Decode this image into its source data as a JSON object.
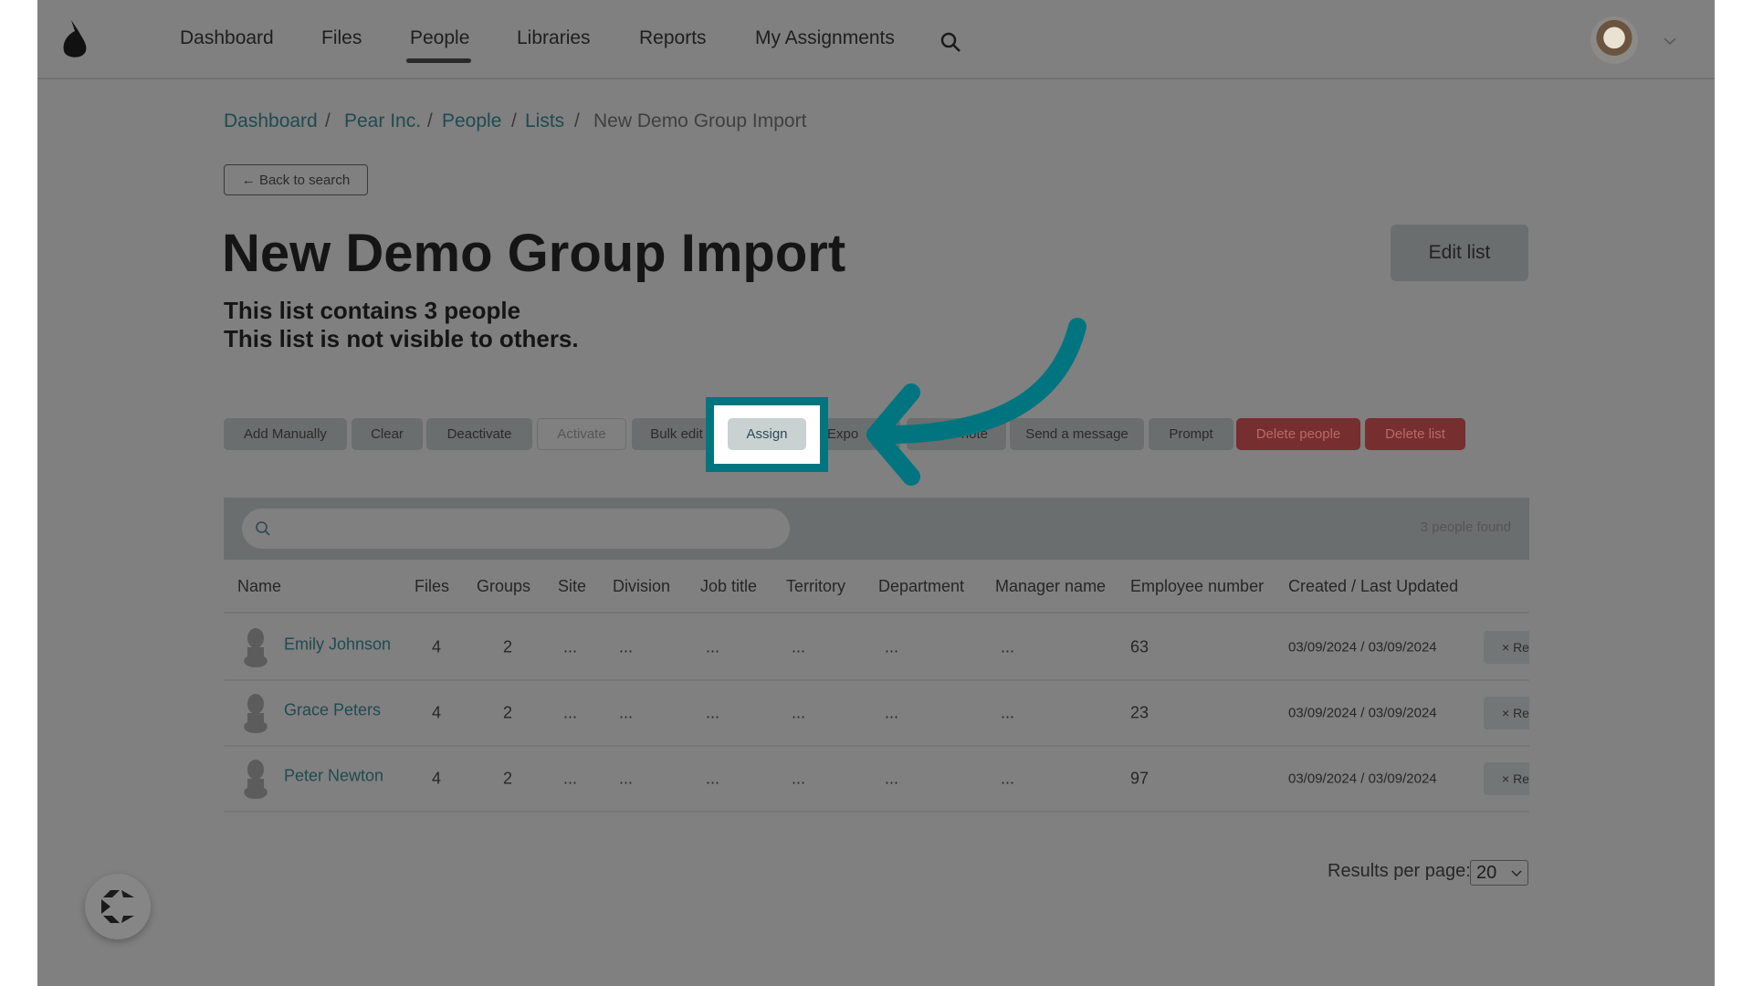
{
  "nav": {
    "items": [
      {
        "label": "Dashboard"
      },
      {
        "label": "Files"
      },
      {
        "label": "People",
        "active": true
      },
      {
        "label": "Libraries"
      },
      {
        "label": "Reports"
      },
      {
        "label": "My Assignments"
      }
    ],
    "search_icon": "search-icon",
    "logo_icon": "pear-logo-icon",
    "avatar": "user-avatar",
    "chevron_icon": "chevron-down-icon"
  },
  "breadcrumb": [
    {
      "label": "Dashboard"
    },
    {
      "label": "Pear Inc."
    },
    {
      "label": "People"
    },
    {
      "label": "Lists"
    },
    {
      "label": "New Demo Group Import"
    }
  ],
  "breadcrumb_sep": "/",
  "back_label": "← Back to search",
  "title": "New Demo Group Import",
  "subtitle1": "This list contains 3 people",
  "subtitle2": "This list is not visible to others.",
  "edit_label": "Edit list",
  "actions": [
    {
      "label": "Add Manually"
    },
    {
      "label": "Clear"
    },
    {
      "label": "Deactivate"
    },
    {
      "label": "Activate",
      "disabled": true
    },
    {
      "label": "Bulk edit"
    },
    {
      "label": "Assign",
      "highlighted": true
    },
    {
      "label": "Expo"
    },
    {
      "label": "note"
    },
    {
      "label": "Send a message"
    },
    {
      "label": "Prompt"
    },
    {
      "label": "Delete people",
      "danger": true
    },
    {
      "label": "Delete list",
      "danger": true
    }
  ],
  "search": {
    "placeholder": "",
    "count": "3 people found"
  },
  "table": {
    "headers": [
      "Name",
      "Files",
      "Groups",
      "Site",
      "Division",
      "Job title",
      "Territory",
      "Department",
      "Manager name",
      "Employee number",
      "Created / Last Updated"
    ],
    "rows": [
      {
        "name": "Emily Johnson",
        "files": "4",
        "groups": "2",
        "site": "...",
        "division": "...",
        "job": "...",
        "territory": "...",
        "department": "...",
        "manager": "...",
        "emp": "63",
        "dates": "03/09/2024 / 03/09/2024",
        "remove": "× Re"
      },
      {
        "name": "Grace Peters",
        "files": "4",
        "groups": "2",
        "site": "...",
        "division": "...",
        "job": "...",
        "territory": "...",
        "department": "...",
        "manager": "...",
        "emp": "23",
        "dates": "03/09/2024 / 03/09/2024",
        "remove": "× Re"
      },
      {
        "name": "Peter Newton",
        "files": "4",
        "groups": "2",
        "site": "...",
        "division": "...",
        "job": "...",
        "territory": "...",
        "department": "...",
        "manager": "...",
        "emp": "97",
        "dates": "03/09/2024 / 03/09/2024",
        "remove": "× Re"
      }
    ]
  },
  "pagination": {
    "label": "Results per page:",
    "value": "20"
  },
  "colors": {
    "accent": "#007580",
    "overlay": "#808080",
    "danger": "#772e2e"
  }
}
